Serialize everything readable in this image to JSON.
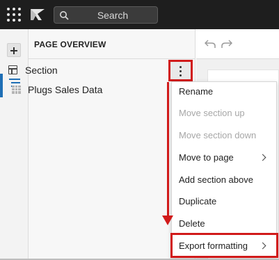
{
  "topbar": {
    "search_label": "Search"
  },
  "panel": {
    "title": "PAGE OVERVIEW",
    "items": [
      {
        "label": "Section",
        "icon": "section-layout-icon"
      },
      {
        "label": "Plugs Sales Data",
        "icon": "table-icon"
      }
    ]
  },
  "context_menu": {
    "items": [
      {
        "label": "Rename",
        "enabled": true
      },
      {
        "label": "Move section up",
        "enabled": false
      },
      {
        "label": "Move section down",
        "enabled": false
      },
      {
        "label": "Move to page",
        "enabled": true,
        "submenu": true
      },
      {
        "label": "Add section above",
        "enabled": true
      },
      {
        "label": "Duplicate",
        "enabled": true
      },
      {
        "label": "Delete",
        "enabled": true
      },
      {
        "label": "Export formatting",
        "enabled": true,
        "submenu": true
      }
    ]
  },
  "colors": {
    "topbar": "#1e1e1e",
    "accent": "#1f6fb5",
    "annotation_red": "#d11a1a",
    "disabled_text": "#a7a7a7"
  }
}
